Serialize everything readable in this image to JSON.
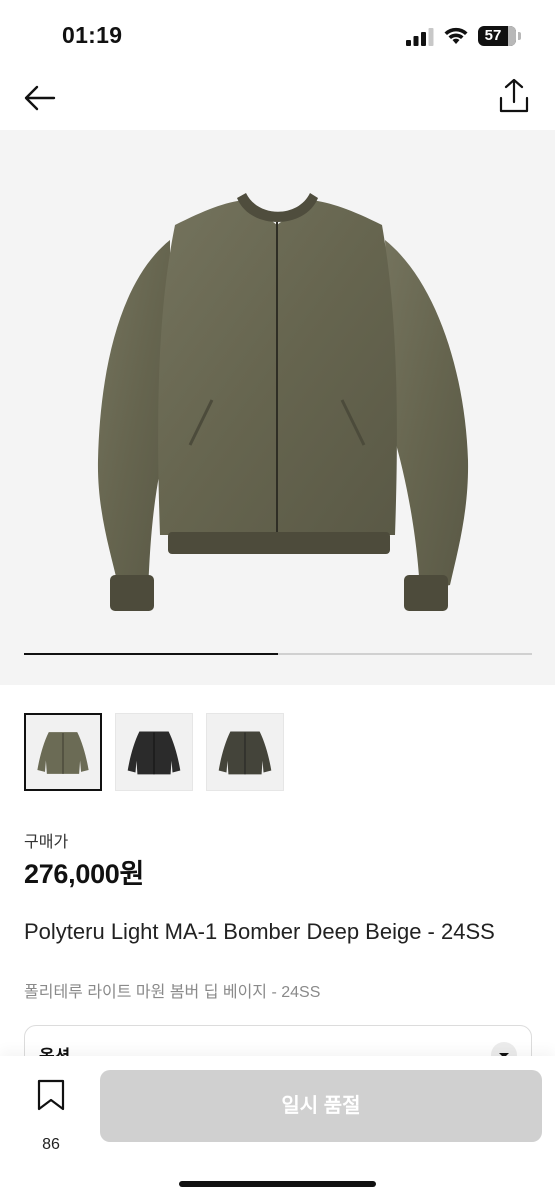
{
  "status_bar": {
    "time": "01:19",
    "battery": "57"
  },
  "nav": {
    "back_icon": "arrow-left-icon",
    "share_icon": "share-upload-icon"
  },
  "gallery": {
    "main_image": "olive bomber jacket photo",
    "slide_progress": 0.5,
    "thumbnails": [
      {
        "name": "thumbnail-olive",
        "selected": true
      },
      {
        "name": "thumbnail-black",
        "selected": false
      },
      {
        "name": "thumbnail-dark-olive",
        "selected": false
      }
    ]
  },
  "product": {
    "price_label": "구매가",
    "price": "276,000원",
    "title_en": "Polyteru Light MA-1 Bomber Deep Beige - 24SS",
    "title_ko": "폴리테루 라이트 마원 봄버 딥 베이지 - 24SS",
    "option_label": "옵션"
  },
  "bottom_bar": {
    "bookmark_count": "86",
    "soldout_label": "일시 품절"
  },
  "colors": {
    "jacket_olive": "#6b6b55",
    "button_disabled": "#d0d0d0",
    "hero_bg": "#f4f4f4"
  }
}
